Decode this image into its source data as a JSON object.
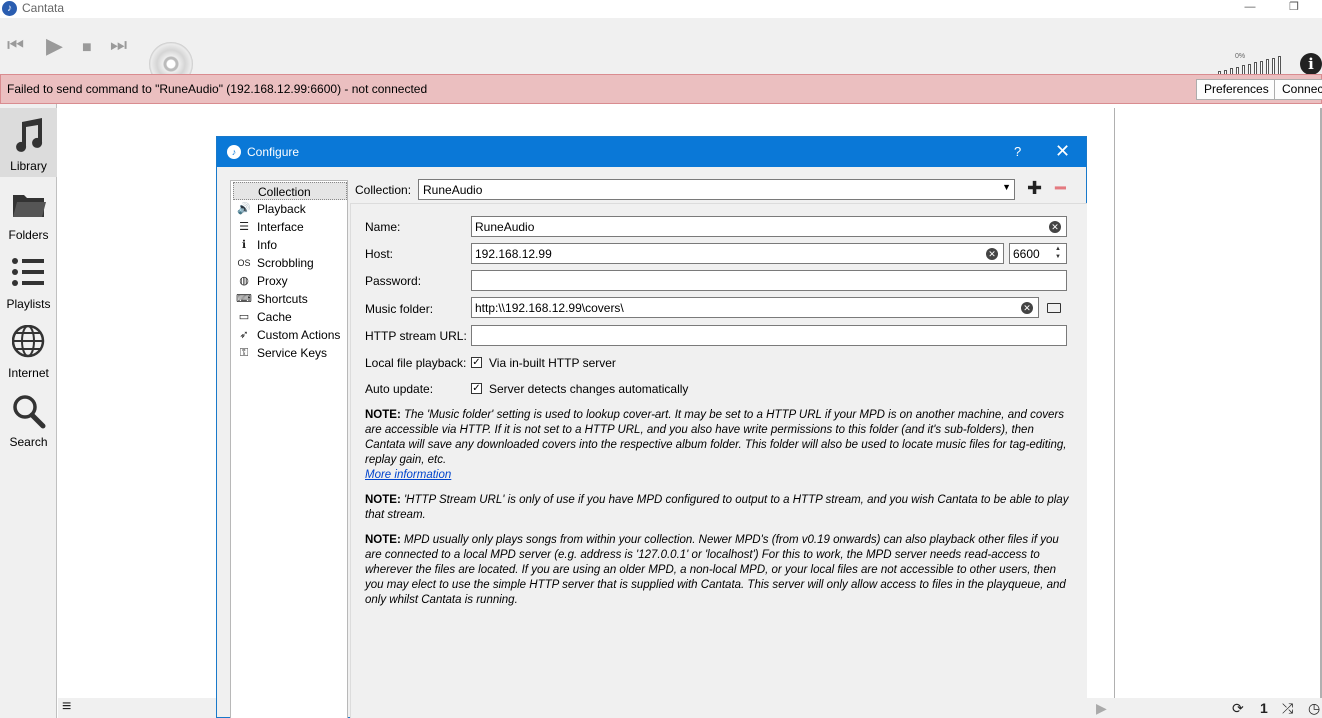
{
  "window": {
    "title": "Cantata",
    "minimize": "—",
    "restore": "❐"
  },
  "toolbar": {
    "volume_text": "0%"
  },
  "error": {
    "message": "Failed to send command to \"RuneAudio\" (192.168.12.99:6600) - not connected",
    "preferences_button": "Preferences",
    "connect_button": "Connect"
  },
  "sidebar": {
    "items": [
      {
        "label": "Library",
        "icon": "music-note-icon"
      },
      {
        "label": "Folders",
        "icon": "folder-icon"
      },
      {
        "label": "Playlists",
        "icon": "list-icon"
      },
      {
        "label": "Internet",
        "icon": "globe-icon"
      },
      {
        "label": "Search",
        "icon": "magnifier-icon"
      }
    ]
  },
  "dialog": {
    "title": "Configure",
    "help": "?",
    "close": "✕",
    "nav": [
      {
        "label": "Collection",
        "icon": ""
      },
      {
        "label": "Playback",
        "icon": "🔊"
      },
      {
        "label": "Interface",
        "icon": "☰"
      },
      {
        "label": "Info",
        "icon": "ℹ"
      },
      {
        "label": "Scrobbling",
        "icon": "OS"
      },
      {
        "label": "Proxy",
        "icon": "◍"
      },
      {
        "label": "Shortcuts",
        "icon": "⌨"
      },
      {
        "label": "Cache",
        "icon": "▭"
      },
      {
        "label": "Custom Actions",
        "icon": "➶"
      },
      {
        "label": "Service Keys",
        "icon": "⚿"
      }
    ],
    "collection_label": "Collection:",
    "collection_value": "RuneAudio",
    "fields": {
      "name_label": "Name:",
      "name_value": "RuneAudio",
      "host_label": "Host:",
      "host_value": "192.168.12.99",
      "port_value": "6600",
      "password_label": "Password:",
      "password_value": "",
      "music_folder_label": "Music folder:",
      "music_folder_value": "http:\\\\192.168.12.99\\covers\\",
      "http_stream_label": "HTTP stream URL:",
      "http_stream_value": "",
      "local_playback_label": "Local file playback:",
      "local_playback_check": "Via in-built HTTP server",
      "auto_update_label": "Auto update:",
      "auto_update_check": "Server detects changes automatically"
    },
    "notes": {
      "note1_prefix": "NOTE:",
      "note1_text": "The 'Music folder' setting is used to lookup cover-art. It may be set to a HTTP URL if your MPD is on another machine, and covers are accessible via HTTP. If it is not set to a HTTP URL, and you also have write permissions to this folder (and it's sub-folders), then Cantata will save any downloaded covers into the respective album folder. This folder will also be used to locate music files for tag-editing, replay gain, etc.",
      "note1_link": "More information",
      "note2_prefix": "NOTE:",
      "note2_text": "'HTTP Stream URL' is only of use if you have MPD configured to output to a HTTP stream, and you wish Cantata to be able to play that stream.",
      "note3_prefix": "NOTE:",
      "note3_text": "MPD usually only plays songs from within your collection. Newer MPD's (from v0.19 onwards) can also playback other files if you are connected to a local MPD server (e.g. address is '127.0.0.1' or 'localhost') For this to work, the MPD server needs read-access to wherever the files are located. If you are using an older MPD, a non-local MPD, or your local files are not accessible to other users, then you may elect to use the simple HTTP server that is supplied with Cantata. This server will only allow access to files in the playqueue, and only whilst Cantata is running."
    }
  },
  "bottombar": {
    "count": "1"
  }
}
